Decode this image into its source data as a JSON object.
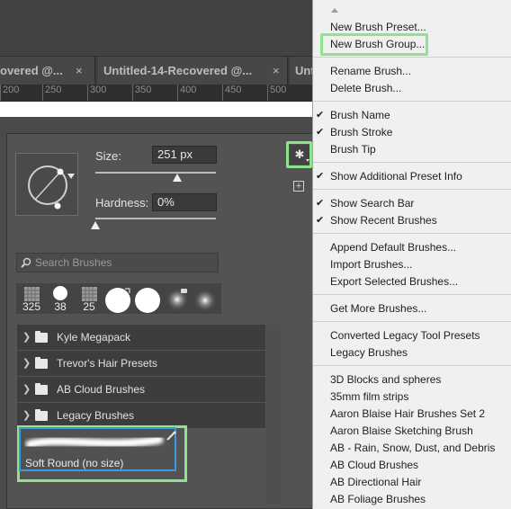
{
  "document_tabs": [
    {
      "label": "overed @...",
      "close": "×"
    },
    {
      "label": "Untitled-14-Recovered @...",
      "close": "×"
    },
    {
      "label": "Unt",
      "close": ""
    }
  ],
  "ruler_ticks": [
    "200",
    "250",
    "300",
    "350",
    "400",
    "450",
    "500"
  ],
  "picker": {
    "size_label": "Size:",
    "size_value": "251 px",
    "size_level": 0.68,
    "hardness_label": "Hardness:",
    "hardness_value": "0%",
    "hardness_level": 0.0,
    "search_placeholder": "Search Brushes",
    "recent_brushes": [
      {
        "kind": "texture",
        "size": "325"
      },
      {
        "kind": "hard-round",
        "size": "38"
      },
      {
        "kind": "texture",
        "size": "25"
      },
      {
        "kind": "hard-large",
        "size": ""
      },
      {
        "kind": "hard-large-2",
        "size": ""
      },
      {
        "kind": "soft-small",
        "size": ""
      },
      {
        "kind": "soft-small-2",
        "size": ""
      }
    ],
    "groups": [
      {
        "name": "Kyle Megapack"
      },
      {
        "name": "Trevor's Hair Presets"
      },
      {
        "name": "AB Cloud Brushes"
      },
      {
        "name": "Legacy Brushes"
      }
    ],
    "selected_brush": {
      "name": "Soft Round (no size)"
    }
  },
  "flyout_menu": {
    "highlight_color": "#8fe38f",
    "sections": [
      [
        {
          "label": "New Brush Preset..."
        },
        {
          "label": "New Brush Group..."
        }
      ],
      [
        {
          "label": "Rename Brush..."
        },
        {
          "label": "Delete Brush..."
        }
      ],
      [
        {
          "label": "Brush Name",
          "checked": true
        },
        {
          "label": "Brush Stroke",
          "checked": true
        },
        {
          "label": "Brush Tip",
          "checked": false
        }
      ],
      [
        {
          "label": "Show Additional Preset Info",
          "checked": true
        }
      ],
      [
        {
          "label": "Show Search Bar",
          "checked": true
        },
        {
          "label": "Show Recent Brushes",
          "checked": true
        }
      ],
      [
        {
          "label": "Append Default Brushes..."
        },
        {
          "label": "Import Brushes..."
        },
        {
          "label": "Export Selected Brushes..."
        }
      ],
      [
        {
          "label": "Get More Brushes..."
        }
      ],
      [
        {
          "label": "Converted Legacy Tool Presets"
        },
        {
          "label": "Legacy Brushes"
        }
      ],
      [
        {
          "label": "3D Blocks and spheres"
        },
        {
          "label": "35mm film strips"
        },
        {
          "label": "Aaron Blaise Hair Brushes Set 2"
        },
        {
          "label": "Aaron Blaise Sketching Brush"
        },
        {
          "label": "AB - Rain, Snow, Dust, and Debris"
        },
        {
          "label": "AB Cloud Brushes"
        },
        {
          "label": "AB Directional Hair"
        },
        {
          "label": "AB Foliage Brushes"
        }
      ]
    ]
  }
}
